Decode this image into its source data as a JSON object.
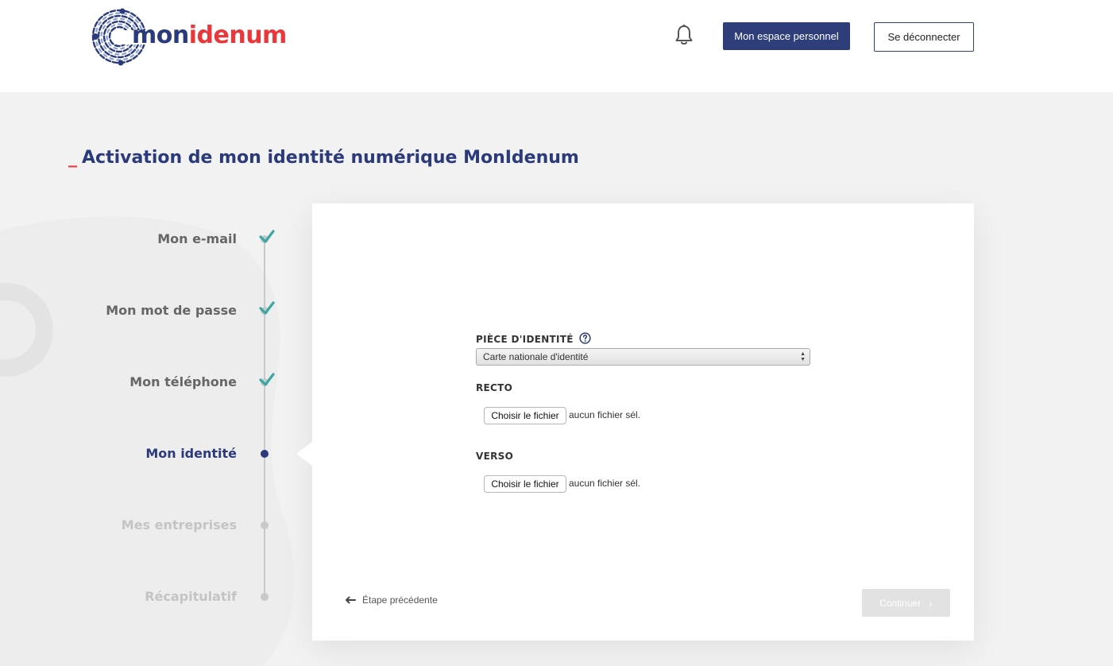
{
  "header": {
    "logo": {
      "part1": "mon",
      "part2": "idenum"
    },
    "notifications_icon": "bell-icon",
    "personal_space_label": "Mon espace personnel",
    "logout_label": "Se déconnecter"
  },
  "page": {
    "title_prefix": "_",
    "title": "Activation de mon identité numérique MonIdenum"
  },
  "steps": [
    {
      "label": "Mon e-mail",
      "state": "done"
    },
    {
      "label": "Mon mot de passe",
      "state": "done"
    },
    {
      "label": "Mon téléphone",
      "state": "done"
    },
    {
      "label": "Mon identité",
      "state": "active"
    },
    {
      "label": "Mes entreprises",
      "state": "pending"
    },
    {
      "label": "Récapitulatif",
      "state": "pending"
    }
  ],
  "form": {
    "id_doc_label": "PIÈCE D'IDENTITÉ",
    "id_doc_help_icon": "help-circle-icon",
    "id_doc_selected": "Carte nationale d'identité",
    "recto_label": "RECTO",
    "recto_button": "Choisir le fichier",
    "recto_status": "aucun fichier sél.",
    "verso_label": "VERSO",
    "verso_button": "Choisir le fichier",
    "verso_status": "aucun fichier sél."
  },
  "footer": {
    "prev_label": "Étape précédente",
    "continue_label": "Continuer"
  },
  "colors": {
    "brand_blue": "#2b3a7a",
    "brand_red": "#e8383c",
    "check_teal": "#3aa7a3"
  }
}
